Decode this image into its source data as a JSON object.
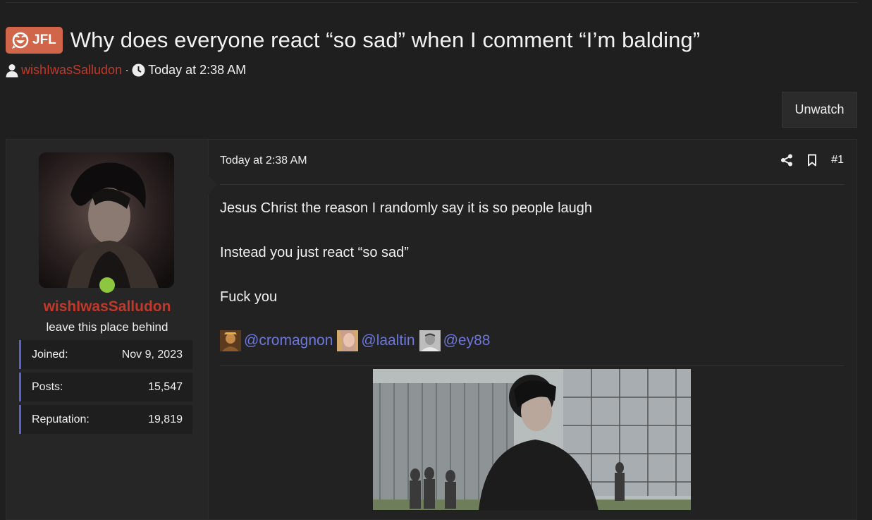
{
  "thread": {
    "prefix": "JFL",
    "title": "Why does everyone react “so sad” when I comment “I’m balding”",
    "author": "wishIwasSalludon",
    "separator": "·",
    "date": "Today at 2:38 AM"
  },
  "buttons": {
    "unwatch": "Unwatch"
  },
  "user": {
    "name": "wishIwasSalludon",
    "title": "leave this place behind",
    "online": true,
    "stats": [
      {
        "label": "Joined:",
        "value": "Nov 9, 2023"
      },
      {
        "label": "Posts:",
        "value": "15,547"
      },
      {
        "label": "Reputation:",
        "value": "19,819"
      }
    ]
  },
  "post": {
    "date": "Today at 2:38 AM",
    "number": "#1",
    "lines": [
      "Jesus Christ the reason I randomly say it is so people laugh",
      "Instead you just react “so sad”",
      "Fuck you"
    ],
    "mentions": [
      "@cromagnon",
      "@laaltin",
      "@ey88"
    ]
  },
  "colors": {
    "background": "#1f1f1f",
    "prefix": "#d0654a",
    "username": "#c0392b",
    "mention": "#6e78d8",
    "stat_accent": "#5a63c9",
    "online": "#8dc63f"
  }
}
